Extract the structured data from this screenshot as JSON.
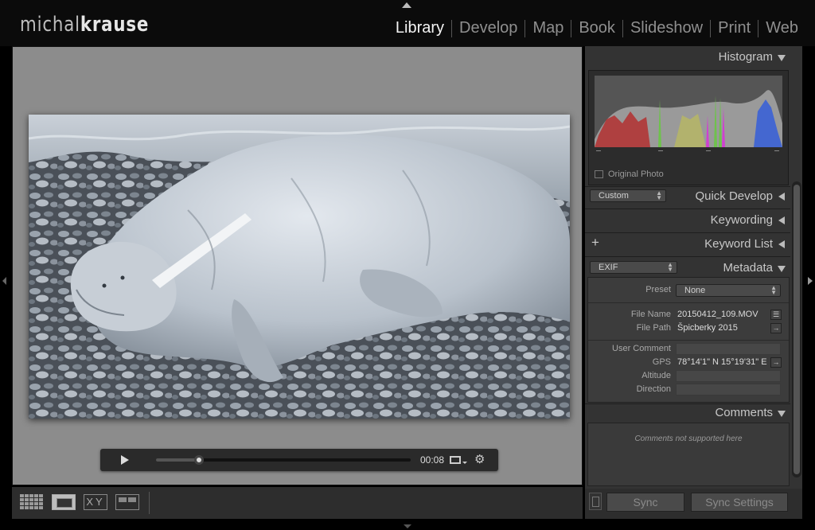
{
  "app": {
    "logo_first": "michal",
    "logo_second": "krause"
  },
  "modules": [
    {
      "label": "Library",
      "active": true
    },
    {
      "label": "Develop",
      "active": false
    },
    {
      "label": "Map",
      "active": false
    },
    {
      "label": "Book",
      "active": false
    },
    {
      "label": "Slideshow",
      "active": false
    },
    {
      "label": "Print",
      "active": false
    },
    {
      "label": "Web",
      "active": false
    }
  ],
  "video": {
    "timecode": "00:08",
    "progress": 0.17
  },
  "panels": {
    "histogram": {
      "title": "Histogram",
      "original_photo_label": "Original Photo"
    },
    "quick_develop": {
      "title": "Quick Develop",
      "preset_dropdown": "Custom"
    },
    "keywording": {
      "title": "Keywording"
    },
    "keyword_list": {
      "title": "Keyword List"
    },
    "metadata": {
      "title": "Metadata",
      "view_dropdown": "EXIF",
      "preset_label": "Preset",
      "preset_value": "None",
      "rows": {
        "file_name": {
          "label": "File Name",
          "value": "20150412_109.MOV"
        },
        "file_path": {
          "label": "File Path",
          "value": "Špicberky 2015"
        },
        "user_comment": {
          "label": "User Comment",
          "value": ""
        },
        "gps": {
          "label": "GPS",
          "value": "78°14'1\" N 15°19'31\" E"
        },
        "altitude": {
          "label": "Altitude",
          "value": ""
        },
        "direction": {
          "label": "Direction",
          "value": ""
        }
      }
    },
    "comments": {
      "title": "Comments",
      "note": "Comments not supported here"
    }
  },
  "sync": {
    "sync_label": "Sync",
    "sync_settings_label": "Sync Settings"
  },
  "colors": {
    "background": "#000000",
    "panel": "#333333",
    "canvas": "#8c8c8c",
    "active_module": "#f4f4f4",
    "inactive_module": "#8f8f8f"
  }
}
